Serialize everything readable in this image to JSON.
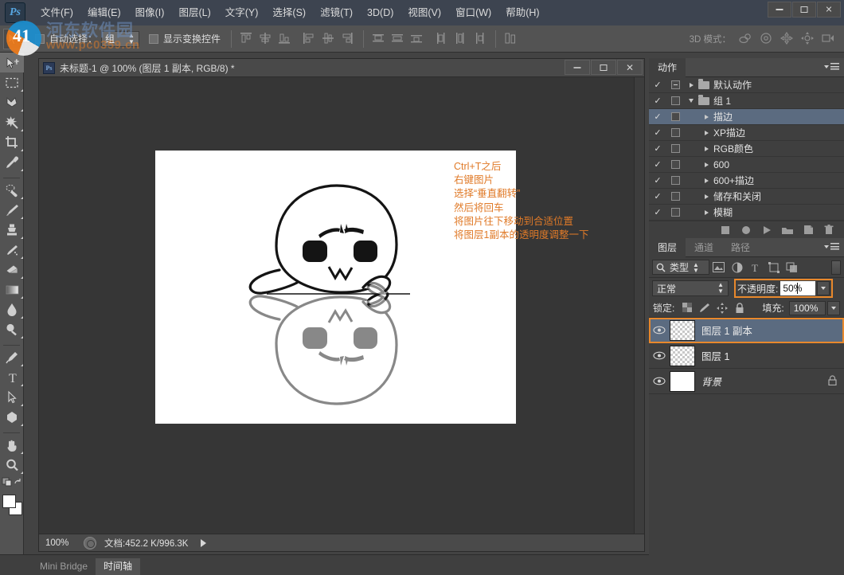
{
  "app": {
    "logo": "Ps",
    "window_controls": {
      "minimize": "minimize-icon",
      "maximize": "maximize-icon",
      "close": "✕"
    }
  },
  "menubar": {
    "items": [
      {
        "label": "文件(F)"
      },
      {
        "label": "编辑(E)"
      },
      {
        "label": "图像(I)"
      },
      {
        "label": "图层(L)"
      },
      {
        "label": "文字(Y)"
      },
      {
        "label": "选择(S)"
      },
      {
        "label": "滤镜(T)"
      },
      {
        "label": "3D(D)"
      },
      {
        "label": "视图(V)"
      },
      {
        "label": "窗口(W)"
      },
      {
        "label": "帮助(H)"
      }
    ]
  },
  "watermark": {
    "badge": "41",
    "site_name": "河东软件园",
    "url": "www.pc0359.cn"
  },
  "options_bar": {
    "auto_select_label": "自动选择：",
    "auto_select_value": "组",
    "show_transform_label": "显示变换控件",
    "mode3d_label": "3D 模式：",
    "align_icons": [
      "align-top-edges-icon",
      "align-vertical-centers-icon",
      "align-bottom-edges-icon",
      "align-left-edges-icon",
      "align-horizontal-centers-icon",
      "align-right-edges-icon"
    ],
    "distribute_icons": [
      "distribute-top-edges-icon",
      "distribute-vertical-centers-icon",
      "distribute-bottom-edges-icon",
      "distribute-left-edges-icon",
      "distribute-horizontal-centers-icon",
      "distribute-right-edges-icon"
    ],
    "extra_icons": [
      "auto-align-layers-icon"
    ],
    "mode3d_icons": [
      "rotate-3d-icon",
      "roll-3d-icon",
      "drag-3d-icon",
      "slide-3d-icon",
      "scale-3d-icon"
    ]
  },
  "toolbar": {
    "tools": [
      {
        "name": "move-tool",
        "selected": true
      },
      {
        "name": "rectangular-marquee-tool",
        "selected": false
      },
      {
        "name": "lasso-tool",
        "selected": false
      },
      {
        "name": "magic-wand-tool",
        "selected": false
      },
      {
        "name": "crop-tool",
        "selected": false
      },
      {
        "name": "eyedropper-tool",
        "selected": false
      },
      {
        "name": "healing-brush-tool",
        "selected": false
      },
      {
        "name": "brush-tool",
        "selected": false
      },
      {
        "name": "clone-stamp-tool",
        "selected": false
      },
      {
        "name": "history-brush-tool",
        "selected": false
      },
      {
        "name": "eraser-tool",
        "selected": false
      },
      {
        "name": "gradient-tool",
        "selected": false
      },
      {
        "name": "blur-tool",
        "selected": false
      },
      {
        "name": "dodge-tool",
        "selected": false
      },
      {
        "name": "pen-tool",
        "selected": false
      },
      {
        "name": "type-tool",
        "selected": false
      },
      {
        "name": "path-selection-tool",
        "selected": false
      },
      {
        "name": "shape-tool",
        "selected": false
      },
      {
        "name": "hand-tool",
        "selected": false
      },
      {
        "name": "zoom-tool",
        "selected": false
      }
    ]
  },
  "document": {
    "title": "未标题-1 @ 100% (图层 1 副本, RGB/8) *",
    "zoom": "100%",
    "status": "文档:452.2 K/996.3K",
    "annotation_lines": [
      "Ctrl+T之后",
      "右键图片",
      "选择“垂直翻转”",
      "然后将回车",
      "将图片往下移动到合适位置",
      "将图层1副本的透明度调整一下"
    ],
    "annotation_color": "#e07a28"
  },
  "actions_panel": {
    "tab": "动作",
    "rows": [
      {
        "checked": "✓",
        "box": "minus",
        "expand": "right",
        "folder": true,
        "label": "默认动作",
        "selected": false
      },
      {
        "checked": "✓",
        "box": "empty",
        "expand": "down",
        "folder": true,
        "label": "组 1",
        "selected": false
      },
      {
        "checked": "✓",
        "box": "empty",
        "expand": "right",
        "folder": false,
        "label": "描边",
        "selected": true
      },
      {
        "checked": "✓",
        "box": "empty",
        "expand": "right",
        "folder": false,
        "label": "XP描边",
        "selected": false
      },
      {
        "checked": "✓",
        "box": "empty",
        "expand": "right",
        "folder": false,
        "label": "RGB颜色",
        "selected": false
      },
      {
        "checked": "✓",
        "box": "empty",
        "expand": "right",
        "folder": false,
        "label": "600",
        "selected": false
      },
      {
        "checked": "✓",
        "box": "empty",
        "expand": "right",
        "folder": false,
        "label": "600+描边",
        "selected": false
      },
      {
        "checked": "✓",
        "box": "empty",
        "expand": "right",
        "folder": false,
        "label": "储存和关闭",
        "selected": false
      },
      {
        "checked": "✓",
        "box": "empty",
        "expand": "right",
        "folder": false,
        "label": "模糊",
        "selected": false
      }
    ],
    "toolbar_icons": [
      "stop-icon",
      "record-icon",
      "play-icon",
      "new-set-icon",
      "new-action-icon",
      "delete-icon"
    ]
  },
  "layers_panel": {
    "tabs": [
      {
        "label": "图层",
        "active": true
      },
      {
        "label": "通道",
        "active": false
      },
      {
        "label": "路径",
        "active": false
      }
    ],
    "filter": {
      "icon": "search-icon",
      "value": "类型",
      "type_icons": [
        "pixel-filter-icon",
        "adjustment-filter-icon",
        "type-filter-icon",
        "shape-filter-icon",
        "smartobject-filter-icon"
      ]
    },
    "blend_mode": "正常",
    "opacity_label": "不透明度:",
    "opacity_value": "50%",
    "lock_label": "锁定:",
    "lock_icons": [
      "lock-transparent-pixels-icon",
      "lock-image-pixels-icon",
      "lock-position-icon",
      "lock-all-icon"
    ],
    "fill_label": "填充:",
    "fill_value": "100%",
    "highlight_color": "#e8882c",
    "layers": [
      {
        "name": "图层 1 副本",
        "visible": true,
        "selected": true,
        "thumb": "transparent",
        "locked": false,
        "background": false
      },
      {
        "name": "图层 1",
        "visible": true,
        "selected": false,
        "thumb": "transparent",
        "locked": false,
        "background": false
      },
      {
        "name": "背景",
        "visible": true,
        "selected": false,
        "thumb": "white",
        "locked": true,
        "background": true
      }
    ]
  },
  "bottom_tabs": [
    {
      "label": "Mini Bridge",
      "active": false
    },
    {
      "label": "时间轴",
      "active": true
    }
  ]
}
